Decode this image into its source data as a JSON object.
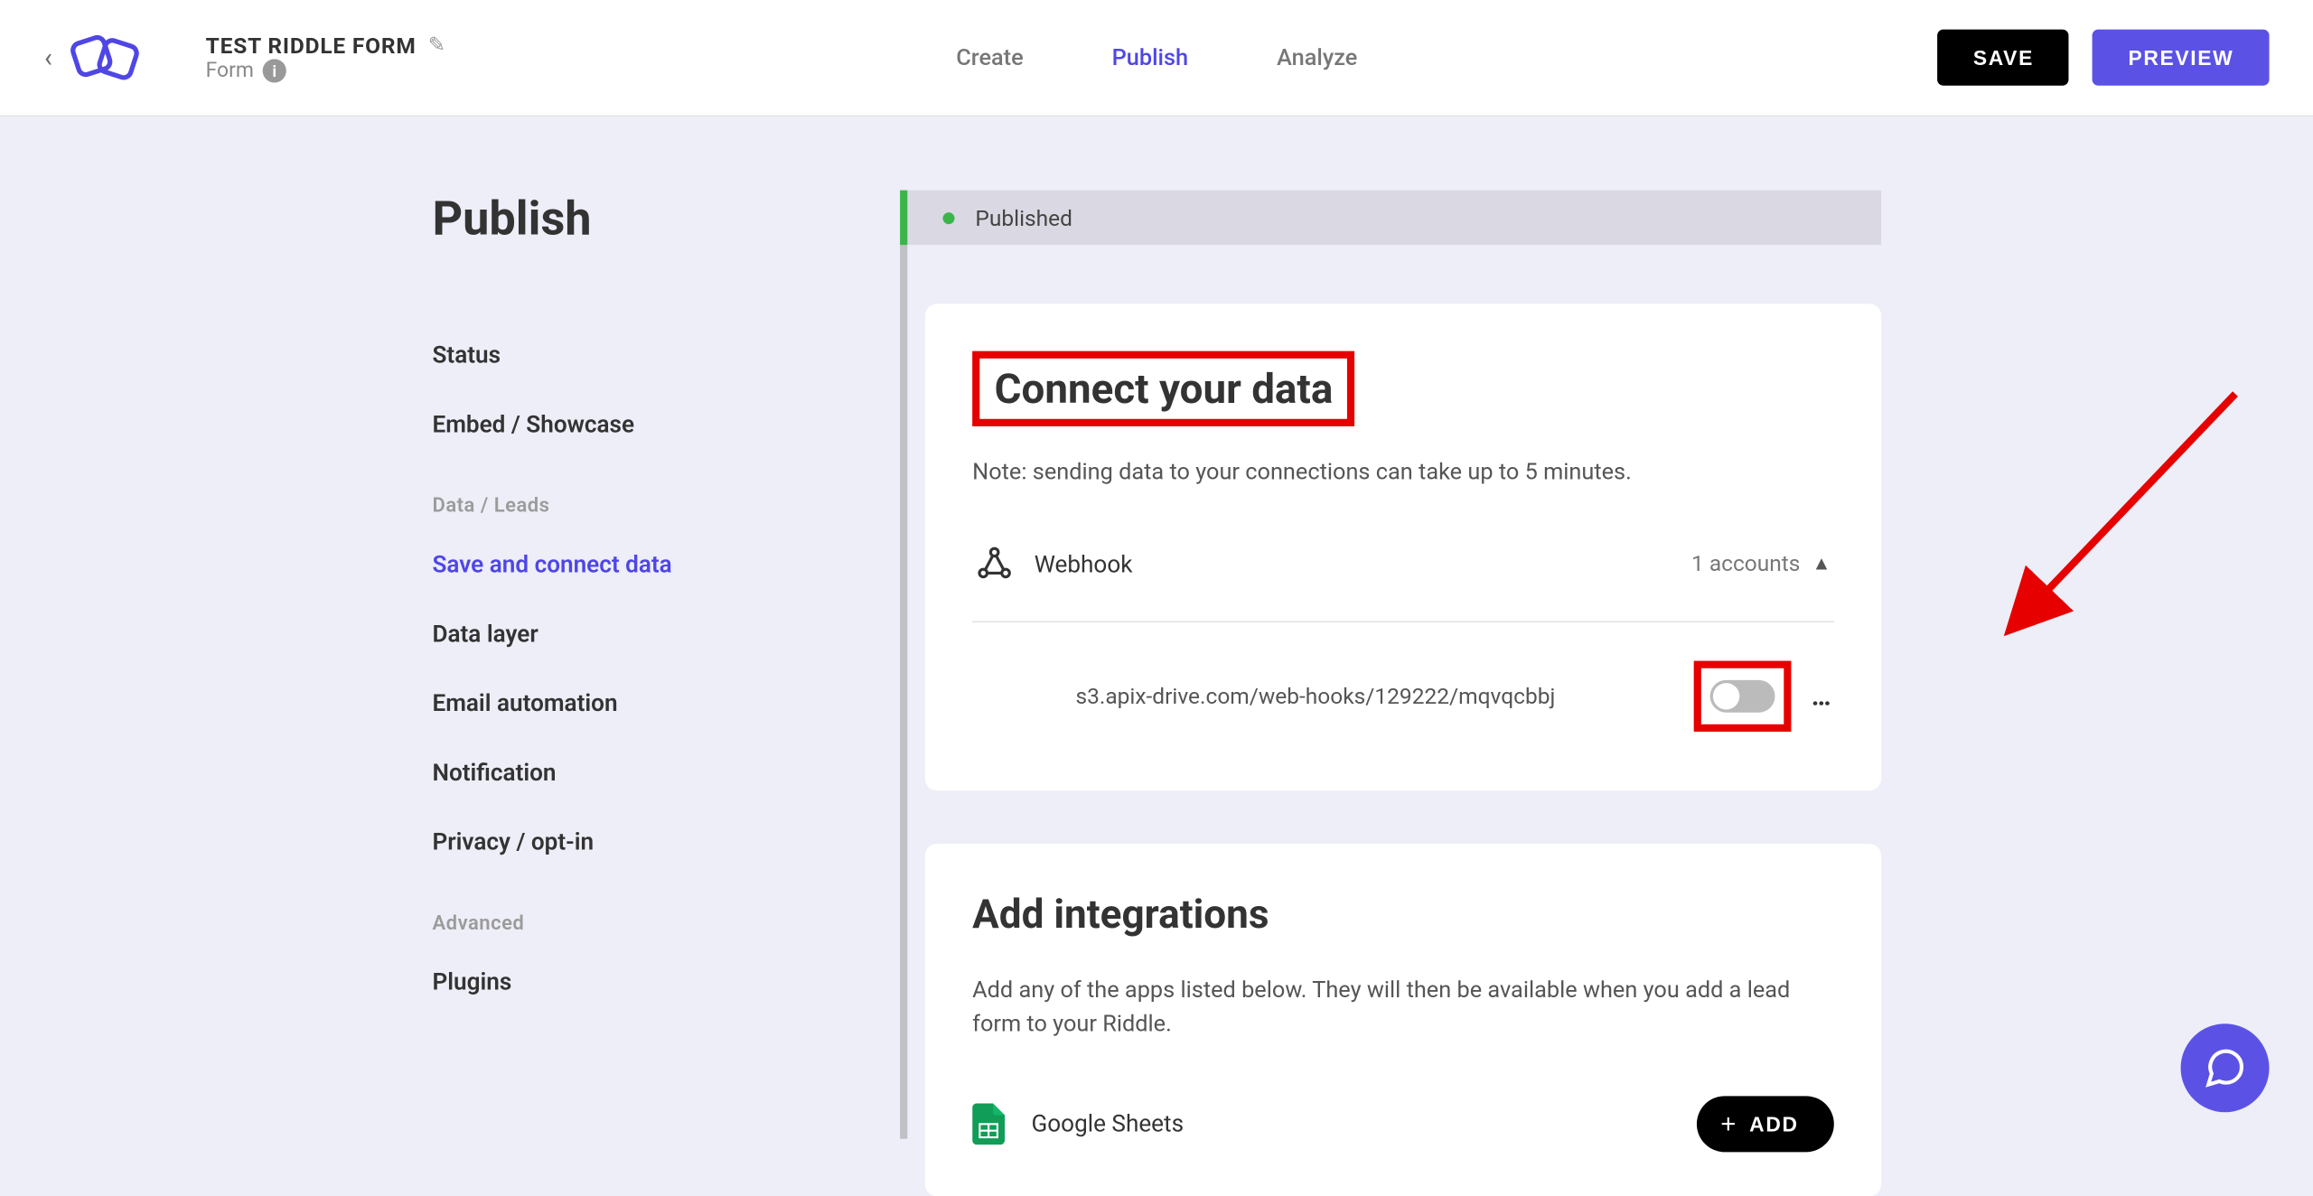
{
  "header": {
    "title": "TEST RIDDLE FORM",
    "subtitle": "Form",
    "tabs": {
      "create": "Create",
      "publish": "Publish",
      "analyze": "Analyze"
    },
    "save": "SAVE",
    "preview": "PREVIEW"
  },
  "sidebar": {
    "heading": "Publish",
    "items": {
      "status": "Status",
      "embed": "Embed / Showcase",
      "group_data": "Data / Leads",
      "save_connect": "Save and connect data",
      "data_layer": "Data layer",
      "email_auto": "Email automation",
      "notification": "Notification",
      "privacy": "Privacy / opt-in",
      "group_adv": "Advanced",
      "plugins": "Plugins"
    }
  },
  "content": {
    "status_label": "Published",
    "connect_title": "Connect your data",
    "connect_note": "Note: sending data to your connections can take up to 5 minutes.",
    "webhook_label": "Webhook",
    "accounts": "1 accounts",
    "webhook_url": "s3.apix-drive.com/web-hooks/129222/mqvqcbbj",
    "integ_title": "Add integrations",
    "integ_desc": "Add any of the apps listed below. They will then be available when you add a lead form to your Riddle.",
    "google_sheets": "Google Sheets",
    "add_btn": "ADD"
  }
}
